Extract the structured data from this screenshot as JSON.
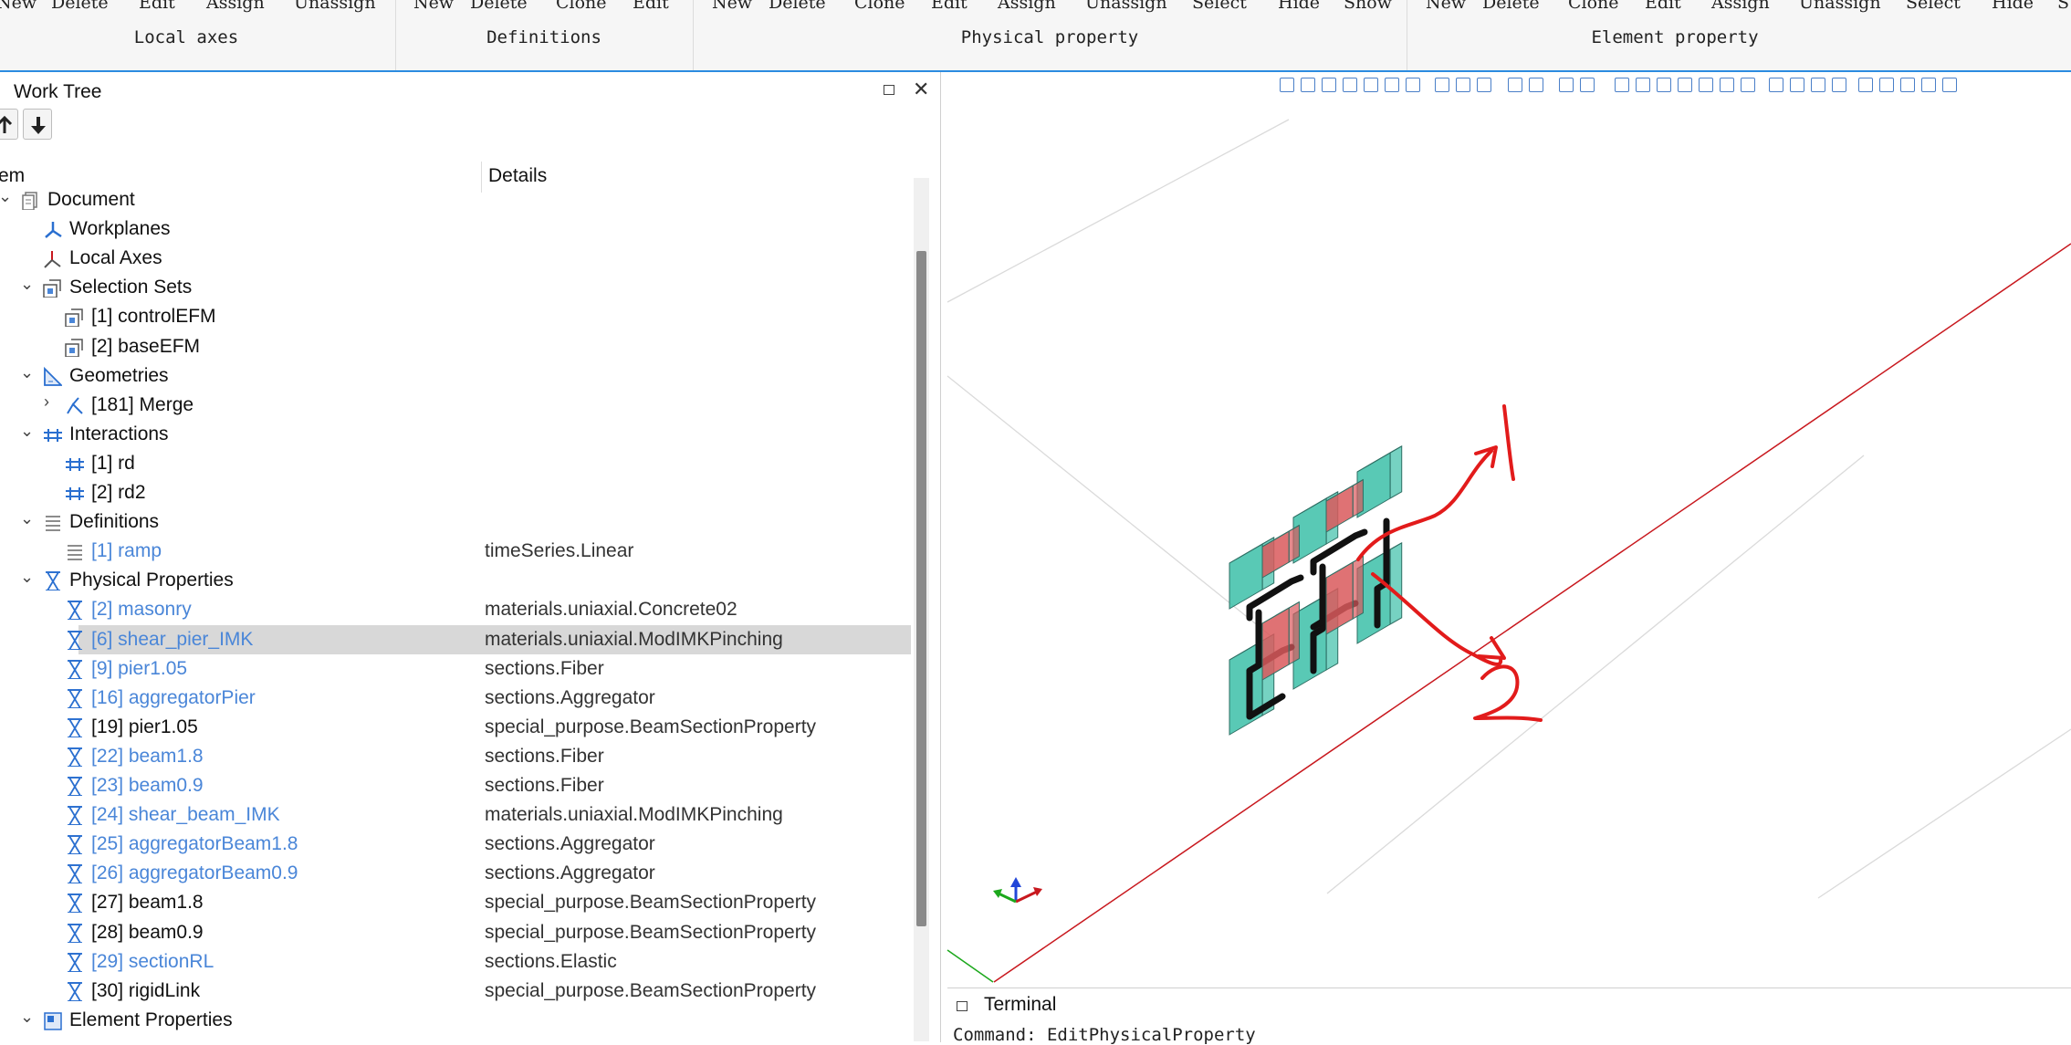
{
  "ribbon": {
    "groups": [
      {
        "label": "Local axes",
        "buttons": [
          "New",
          "Delete",
          "Edit",
          "Assign",
          "Unassign"
        ]
      },
      {
        "label": "Definitions",
        "buttons": [
          "New",
          "Delete",
          "Clone",
          "Edit"
        ]
      },
      {
        "label": "Physical property",
        "buttons": [
          "New",
          "Delete",
          "Clone",
          "Edit",
          "Assign",
          "Unassign",
          "Select",
          "Hide",
          "Show"
        ]
      },
      {
        "label": "Element property",
        "buttons": [
          "New",
          "Delete",
          "Clone",
          "Edit",
          "Assign",
          "Unassign",
          "Select",
          "Hide",
          "S"
        ]
      }
    ]
  },
  "worktree": {
    "title": "Work Tree",
    "columns": {
      "item": "em",
      "details": "Details"
    },
    "rows": [
      {
        "label": "Document",
        "details": "",
        "depth": 0,
        "chev": "⌄",
        "icon": "document-icon",
        "style": "black"
      },
      {
        "label": "Workplanes",
        "details": "",
        "depth": 1,
        "chev": "",
        "icon": "workplane-icon",
        "style": "black"
      },
      {
        "label": "Local Axes",
        "details": "",
        "depth": 1,
        "chev": "",
        "icon": "axes-icon",
        "style": "black"
      },
      {
        "label": "Selection Sets",
        "details": "",
        "depth": 1,
        "chev": "⌄",
        "icon": "selection-set-icon",
        "style": "black"
      },
      {
        "label": "[1] controlEFM",
        "details": "",
        "depth": 2,
        "chev": "",
        "icon": "selection-set-icon",
        "style": "black"
      },
      {
        "label": "[2] baseEFM",
        "details": "",
        "depth": 2,
        "chev": "",
        "icon": "selection-set-icon",
        "style": "black"
      },
      {
        "label": "Geometries",
        "details": "",
        "depth": 1,
        "chev": "⌄",
        "icon": "geometry-icon",
        "style": "black"
      },
      {
        "label": "[181] Merge",
        "details": "",
        "depth": 2,
        "chev": "›",
        "icon": "merge-icon",
        "style": "black"
      },
      {
        "label": "Interactions",
        "details": "",
        "depth": 1,
        "chev": "⌄",
        "icon": "interaction-icon",
        "style": "black"
      },
      {
        "label": "[1] rd",
        "details": "",
        "depth": 2,
        "chev": "",
        "icon": "interaction-icon",
        "style": "black"
      },
      {
        "label": "[2] rd2",
        "details": "",
        "depth": 2,
        "chev": "",
        "icon": "interaction-icon",
        "style": "black"
      },
      {
        "label": "Definitions",
        "details": "",
        "depth": 1,
        "chev": "⌄",
        "icon": "list-icon",
        "style": "black"
      },
      {
        "label": "[1] ramp",
        "details": "timeSeries.Linear",
        "depth": 2,
        "chev": "",
        "icon": "list-icon",
        "style": "blue"
      },
      {
        "label": "Physical Properties",
        "details": "",
        "depth": 1,
        "chev": "⌄",
        "icon": "hourglass-icon",
        "style": "black"
      },
      {
        "label": "[2] masonry",
        "details": "materials.uniaxial.Concrete02",
        "depth": 2,
        "chev": "",
        "icon": "hourglass-icon",
        "style": "blue"
      },
      {
        "label": "[6] shear_pier_IMK",
        "details": "materials.uniaxial.ModIMKPinching",
        "depth": 2,
        "chev": "",
        "icon": "hourglass-icon",
        "style": "blue",
        "selected": true
      },
      {
        "label": "[9] pier1.05",
        "details": "sections.Fiber",
        "depth": 2,
        "chev": "",
        "icon": "hourglass-icon",
        "style": "blue"
      },
      {
        "label": "[16] aggregatorPier",
        "details": "sections.Aggregator",
        "depth": 2,
        "chev": "",
        "icon": "hourglass-icon",
        "style": "blue"
      },
      {
        "label": "[19] pier1.05",
        "details": "special_purpose.BeamSectionProperty",
        "depth": 2,
        "chev": "",
        "icon": "hourglass-icon",
        "style": "black"
      },
      {
        "label": "[22] beam1.8",
        "details": "sections.Fiber",
        "depth": 2,
        "chev": "",
        "icon": "hourglass-icon",
        "style": "blue"
      },
      {
        "label": "[23] beam0.9",
        "details": "sections.Fiber",
        "depth": 2,
        "chev": "",
        "icon": "hourglass-icon",
        "style": "blue"
      },
      {
        "label": "[24] shear_beam_IMK",
        "details": "materials.uniaxial.ModIMKPinching",
        "depth": 2,
        "chev": "",
        "icon": "hourglass-icon",
        "style": "blue"
      },
      {
        "label": "[25] aggregatorBeam1.8",
        "details": "sections.Aggregator",
        "depth": 2,
        "chev": "",
        "icon": "hourglass-icon",
        "style": "blue"
      },
      {
        "label": "[26] aggregatorBeam0.9",
        "details": "sections.Aggregator",
        "depth": 2,
        "chev": "",
        "icon": "hourglass-icon",
        "style": "blue"
      },
      {
        "label": "[27] beam1.8",
        "details": "special_purpose.BeamSectionProperty",
        "depth": 2,
        "chev": "",
        "icon": "hourglass-icon",
        "style": "black"
      },
      {
        "label": "[28] beam0.9",
        "details": "special_purpose.BeamSectionProperty",
        "depth": 2,
        "chev": "",
        "icon": "hourglass-icon",
        "style": "black"
      },
      {
        "label": "[29] sectionRL",
        "details": "sections.Elastic",
        "depth": 2,
        "chev": "",
        "icon": "hourglass-icon",
        "style": "blue"
      },
      {
        "label": "[30] rigidLink",
        "details": "special_purpose.BeamSectionProperty",
        "depth": 2,
        "chev": "",
        "icon": "hourglass-icon",
        "style": "black"
      },
      {
        "label": "Element Properties",
        "details": "",
        "depth": 1,
        "chev": "⌄",
        "icon": "element-property-icon",
        "style": "black"
      }
    ]
  },
  "viewport": {
    "annotations": [
      "1",
      "2"
    ],
    "colors": {
      "pier": "#3cbfa8",
      "spring": "#d9595c",
      "rigid": "#111111",
      "axis_x": "#c8181e",
      "axis_y": "#1ca81c"
    }
  },
  "terminal": {
    "title": "Terminal",
    "command": "Command: EditPhysicalProperty"
  }
}
